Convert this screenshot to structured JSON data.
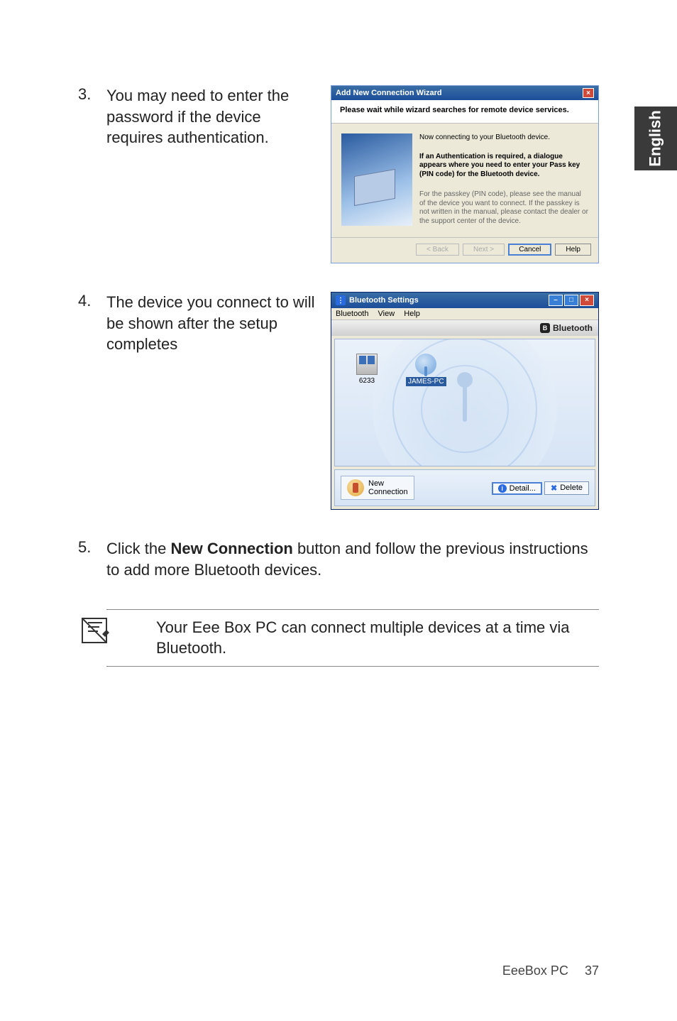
{
  "side_tab": "English",
  "steps": {
    "s3": {
      "num": "3.",
      "text": "You may need to enter the password if the device requires authentication."
    },
    "s4": {
      "num": "4.",
      "text": "The device you connect to will be shown after the setup completes"
    },
    "s5": {
      "num": "5.",
      "text_pre": "Click the ",
      "bold": "New Connection",
      "text_post": " button and follow the previous instructions to add more Bluetooth devices."
    }
  },
  "wizard": {
    "title": "Add New Connection Wizard",
    "head": "Please wait while wizard searches for remote device services.",
    "connecting": "Now connecting to your Bluetooth device.",
    "auth": "If an Authentication is required, a dialogue appears where you need to enter your Pass key (PIN code) for the Bluetooth device.",
    "fine": "For the passkey (PIN code), please see the manual of the device you want to connect. If the passkey is not written in the manual, please contact the dealer or the support center of the device.",
    "btn_back": "< Back",
    "btn_next": "Next >",
    "btn_cancel": "Cancel",
    "btn_help": "Help"
  },
  "bts": {
    "title": "Bluetooth Settings",
    "menu": {
      "m1": "Bluetooth",
      "m2": "View",
      "m3": "Help"
    },
    "brand": "Bluetooth",
    "dev1_label": "6233",
    "dev2_label": "JAMES-PC",
    "newconn_l1": "New",
    "newconn_l2": "Connection",
    "btn_detail": "Detail...",
    "btn_delete": "Delete"
  },
  "note": "Your Eee Box PC can connect multiple devices at a time via Bluetooth.",
  "footer": {
    "product": "EeeBox PC",
    "page": "37"
  }
}
